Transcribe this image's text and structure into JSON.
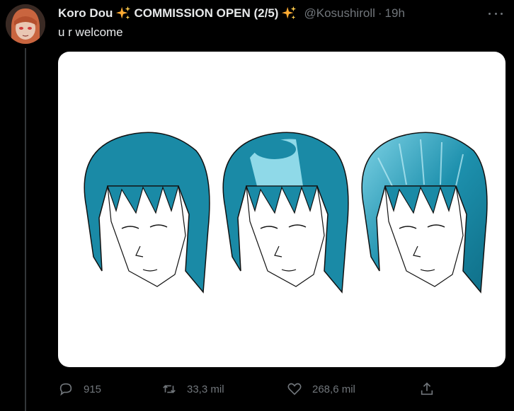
{
  "tweet": {
    "display_name": "Koro Dou",
    "display_name_suffix": "COMMISSION OPEN (2/5)",
    "handle": "@Kosushiroll",
    "separator": "·",
    "time": "19h",
    "text": "u r welcome"
  },
  "media": {
    "description_icon": "hair-illustration-image",
    "hair_color": "#1a8aa6",
    "hair_highlight": "#8fd9e8",
    "background": "#ffffff"
  },
  "actions": {
    "reply_count": "915",
    "retweet_count": "33,3 mil",
    "like_count": "268,6 mil"
  },
  "colors": {
    "background": "#000000",
    "text": "#e7e9ea",
    "muted": "#71767b",
    "sparkle": "#ffac33"
  }
}
